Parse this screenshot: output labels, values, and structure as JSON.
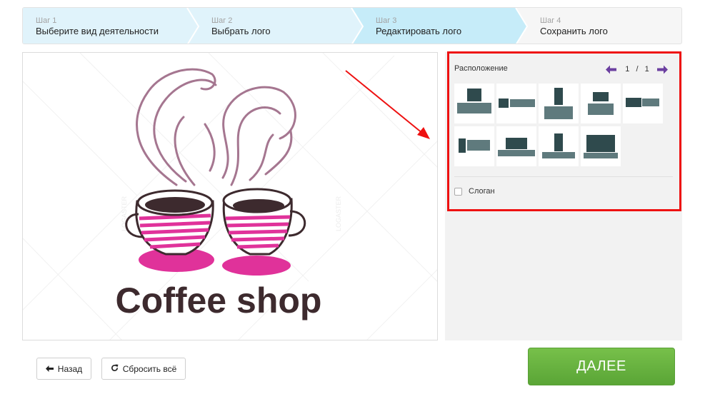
{
  "steps": [
    {
      "number": "Шаг 1",
      "label": "Выберите вид деятельности"
    },
    {
      "number": "Шаг 2",
      "label": "Выбрать лого"
    },
    {
      "number": "Шаг 3",
      "label": "Редактировать лого"
    },
    {
      "number": "Шаг 4",
      "label": "Сохранить лого"
    }
  ],
  "logo": {
    "text": "Coffee shop",
    "watermark": "LOGASTER"
  },
  "panel": {
    "title": "Расположение",
    "page_current": "1",
    "page_separator": "/",
    "page_total": "1",
    "slogan_label": "Слоган",
    "slogan_checked": false
  },
  "colors": {
    "accent_purple": "#6b3fa0",
    "highlight_red": "#ee1111",
    "step_active_bg": "#c6ecf9",
    "step_done_bg": "#e2f4fb",
    "next_green": "#64ac3f",
    "logo_pink": "#e0329a",
    "logo_brown": "#3d2a2e"
  },
  "buttons": {
    "back": "Назад",
    "reset": "Сбросить всё",
    "next": "ДАЛЕЕ"
  }
}
